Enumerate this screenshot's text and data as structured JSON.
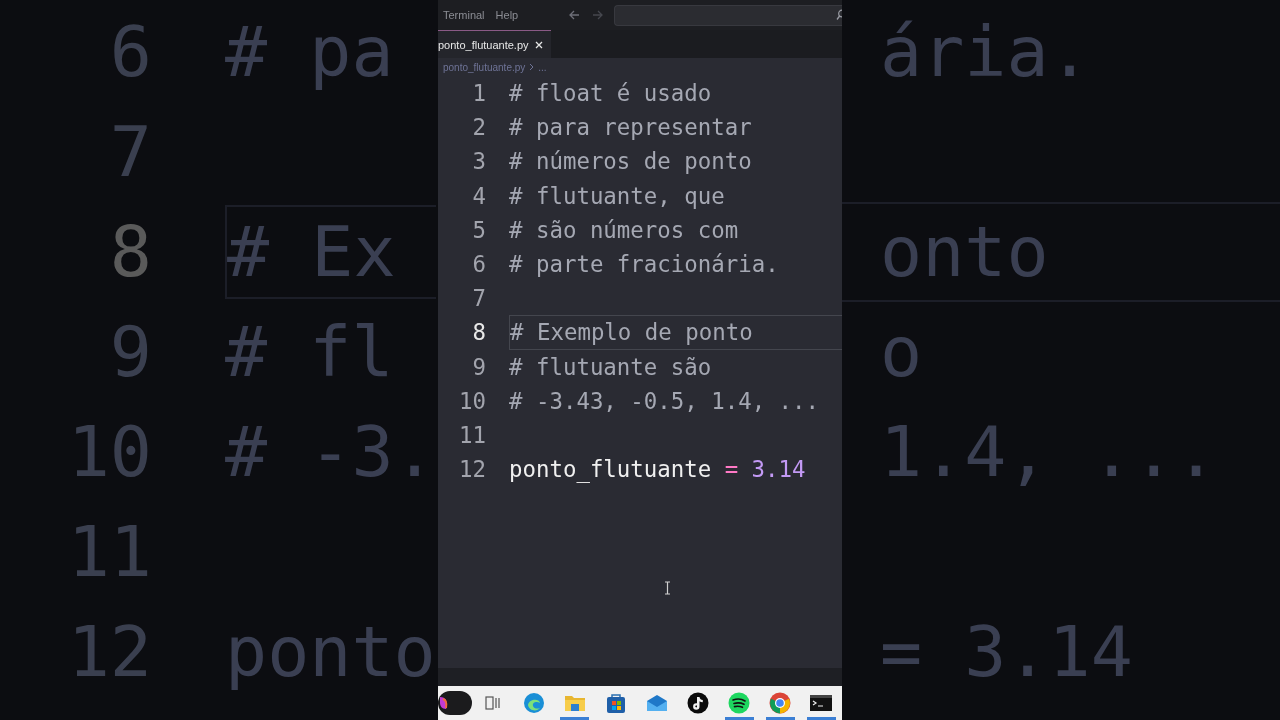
{
  "backdrop": {
    "rows": [
      {
        "number": "6",
        "left_text": "# pa",
        "right_text": "ária.",
        "current": false
      },
      {
        "number": "7",
        "current": false
      },
      {
        "number": "8",
        "left_text": "# Ex",
        "right_text": "onto",
        "current": true
      },
      {
        "number": "9",
        "left_text": "# fl",
        "right_text": "o",
        "current": false
      },
      {
        "number": "10",
        "left_text": "# -3.",
        "right_text": "1.4, ...",
        "current": false
      },
      {
        "number": "11",
        "current": false
      },
      {
        "number": "12",
        "left_text": "ponto",
        "right_text": "= 3.14",
        "current": false
      }
    ]
  },
  "menu": [
    "Terminal",
    "Help"
  ],
  "tabs": [
    {
      "label": "ponto_flutuante.py",
      "selected": true
    }
  ],
  "breadcrumb": [
    "ponto_flutuante.py",
    "..."
  ],
  "lines": [
    {
      "number": "1",
      "current": false,
      "tokens": [
        {
          "kind": "comment",
          "text": "# float é usado"
        }
      ]
    },
    {
      "number": "2",
      "current": false,
      "tokens": [
        {
          "kind": "comment",
          "text": "# para representar"
        }
      ]
    },
    {
      "number": "3",
      "current": false,
      "tokens": [
        {
          "kind": "comment",
          "text": "# números de ponto"
        }
      ]
    },
    {
      "number": "4",
      "current": false,
      "tokens": [
        {
          "kind": "comment",
          "text": "# flutuante, que"
        }
      ]
    },
    {
      "number": "5",
      "current": false,
      "tokens": [
        {
          "kind": "comment",
          "text": "# são números com"
        }
      ]
    },
    {
      "number": "6",
      "current": false,
      "tokens": [
        {
          "kind": "comment",
          "text": "# parte fracionária."
        }
      ]
    },
    {
      "number": "7",
      "current": false
    },
    {
      "number": "8",
      "current": true,
      "tokens": [
        {
          "kind": "comment",
          "text": "# Exemplo de ponto"
        }
      ]
    },
    {
      "number": "9",
      "current": false,
      "tokens": [
        {
          "kind": "comment",
          "text": "# flutuante são"
        }
      ]
    },
    {
      "number": "10",
      "current": false,
      "tokens": [
        {
          "kind": "comment",
          "text": "# -3.43, -0.5, 1.4, ..."
        }
      ]
    },
    {
      "number": "11",
      "current": false
    },
    {
      "number": "12",
      "current": false,
      "tokens": [
        {
          "kind": "name",
          "text": "ponto_flutuante"
        },
        {
          "kind": "operator",
          "text": "="
        },
        {
          "kind": "number",
          "text": "3.14"
        }
      ]
    }
  ],
  "taskbar": [
    {
      "kind": "swirl",
      "open": false
    },
    {
      "kind": "taskview",
      "open": false
    },
    {
      "kind": "wave",
      "open": false
    },
    {
      "kind": "folder",
      "open": true
    },
    {
      "kind": "bag",
      "open": false
    },
    {
      "kind": "mail",
      "open": false
    },
    {
      "kind": "note",
      "open": false
    },
    {
      "kind": "bars",
      "open": true
    },
    {
      "kind": "ring",
      "open": true
    },
    {
      "kind": "terminal",
      "open": true
    }
  ]
}
